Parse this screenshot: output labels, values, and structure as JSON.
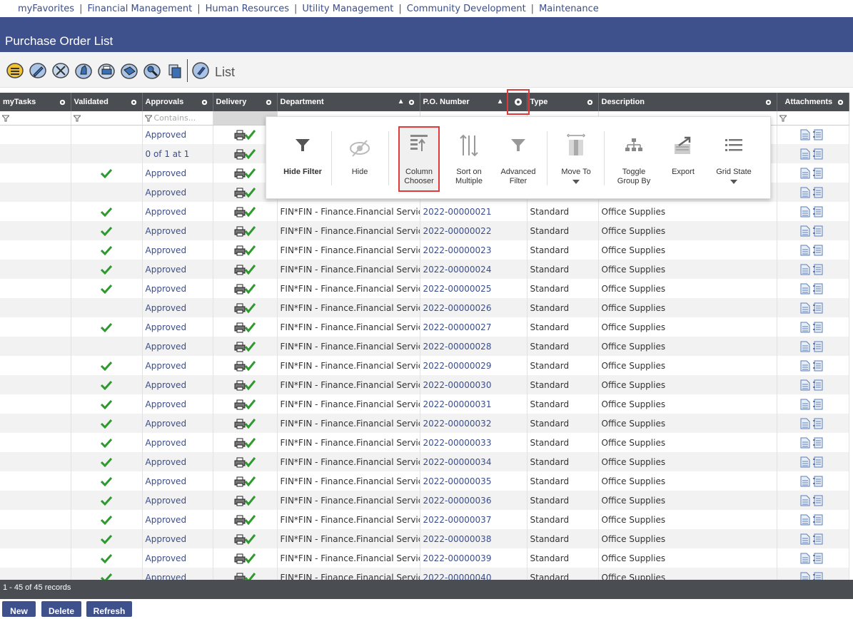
{
  "nav": {
    "items": [
      "myFavorites",
      "Financial Management",
      "Human Resources",
      "Utility Management",
      "Community Development",
      "Maintenance"
    ]
  },
  "title": "Purchase Order List",
  "toolbar": {
    "list_label": "List"
  },
  "columns": [
    "myTasks",
    "Validated",
    "Approvals",
    "Delivery",
    "Department",
    "P.O. Number",
    "Type",
    "Description",
    "Attachments"
  ],
  "filter": {
    "approvals_placeholder": "Contains..."
  },
  "rows": [
    {
      "validated": false,
      "approval": "Approved",
      "department": "",
      "po": "",
      "type": "",
      "description": ""
    },
    {
      "validated": false,
      "approval": "0 of 1 at 1",
      "department": "",
      "po": "",
      "type": "",
      "description": ""
    },
    {
      "validated": true,
      "approval": "Approved",
      "department": "",
      "po": "",
      "type": "",
      "description": ""
    },
    {
      "validated": false,
      "approval": "Approved",
      "department": "",
      "po": "",
      "type": "",
      "description": ""
    },
    {
      "validated": true,
      "approval": "Approved",
      "department": "FIN*FIN - Finance.Financial Services",
      "po": "2022-00000021",
      "type": "Standard",
      "description": "Office Supplies"
    },
    {
      "validated": true,
      "approval": "Approved",
      "department": "FIN*FIN - Finance.Financial Services",
      "po": "2022-00000022",
      "type": "Standard",
      "description": "Office Supplies"
    },
    {
      "validated": true,
      "approval": "Approved",
      "department": "FIN*FIN - Finance.Financial Services",
      "po": "2022-00000023",
      "type": "Standard",
      "description": "Office Supplies"
    },
    {
      "validated": true,
      "approval": "Approved",
      "department": "FIN*FIN - Finance.Financial Services",
      "po": "2022-00000024",
      "type": "Standard",
      "description": "Office Supplies"
    },
    {
      "validated": true,
      "approval": "Approved",
      "department": "FIN*FIN - Finance.Financial Services",
      "po": "2022-00000025",
      "type": "Standard",
      "description": "Office Supplies"
    },
    {
      "validated": false,
      "approval": "Approved",
      "department": "FIN*FIN - Finance.Financial Services",
      "po": "2022-00000026",
      "type": "Standard",
      "description": "Office Supplies"
    },
    {
      "validated": true,
      "approval": "Approved",
      "department": "FIN*FIN - Finance.Financial Services",
      "po": "2022-00000027",
      "type": "Standard",
      "description": "Office Supplies"
    },
    {
      "validated": false,
      "approval": "Approved",
      "department": "FIN*FIN - Finance.Financial Services",
      "po": "2022-00000028",
      "type": "Standard",
      "description": "Office Supplies"
    },
    {
      "validated": true,
      "approval": "Approved",
      "department": "FIN*FIN - Finance.Financial Services",
      "po": "2022-00000029",
      "type": "Standard",
      "description": "Office Supplies"
    },
    {
      "validated": true,
      "approval": "Approved",
      "department": "FIN*FIN - Finance.Financial Services",
      "po": "2022-00000030",
      "type": "Standard",
      "description": "Office Supplies"
    },
    {
      "validated": true,
      "approval": "Approved",
      "department": "FIN*FIN - Finance.Financial Services",
      "po": "2022-00000031",
      "type": "Standard",
      "description": "Office Supplies"
    },
    {
      "validated": true,
      "approval": "Approved",
      "department": "FIN*FIN - Finance.Financial Services",
      "po": "2022-00000032",
      "type": "Standard",
      "description": "Office Supplies"
    },
    {
      "validated": true,
      "approval": "Approved",
      "department": "FIN*FIN - Finance.Financial Services",
      "po": "2022-00000033",
      "type": "Standard",
      "description": "Office Supplies"
    },
    {
      "validated": true,
      "approval": "Approved",
      "department": "FIN*FIN - Finance.Financial Services",
      "po": "2022-00000034",
      "type": "Standard",
      "description": "Office Supplies"
    },
    {
      "validated": true,
      "approval": "Approved",
      "department": "FIN*FIN - Finance.Financial Services",
      "po": "2022-00000035",
      "type": "Standard",
      "description": "Office Supplies"
    },
    {
      "validated": true,
      "approval": "Approved",
      "department": "FIN*FIN - Finance.Financial Services",
      "po": "2022-00000036",
      "type": "Standard",
      "description": "Office Supplies"
    },
    {
      "validated": true,
      "approval": "Approved",
      "department": "FIN*FIN - Finance.Financial Services",
      "po": "2022-00000037",
      "type": "Standard",
      "description": "Office Supplies"
    },
    {
      "validated": true,
      "approval": "Approved",
      "department": "FIN*FIN - Finance.Financial Services",
      "po": "2022-00000038",
      "type": "Standard",
      "description": "Office Supplies"
    },
    {
      "validated": true,
      "approval": "Approved",
      "department": "FIN*FIN - Finance.Financial Services",
      "po": "2022-00000039",
      "type": "Standard",
      "description": "Office Supplies"
    },
    {
      "validated": true,
      "approval": "Approved",
      "department": "FIN*FIN - Finance.Financial Services",
      "po": "2022-00000040",
      "type": "Standard",
      "description": "Office Supplies"
    }
  ],
  "popup": {
    "hide_filter": "Hide Filter",
    "hide": "Hide",
    "column_chooser_1": "Column",
    "column_chooser_2": "Chooser",
    "sort_multiple_1": "Sort on",
    "sort_multiple_2": "Multiple",
    "advanced_filter_1": "Advanced",
    "advanced_filter_2": "Filter",
    "move_to": "Move To",
    "toggle_group_1": "Toggle",
    "toggle_group_2": "Group By",
    "export": "Export",
    "grid_state": "Grid State"
  },
  "status": "1 - 45 of 45 records",
  "buttons": {
    "new": "New",
    "delete": "Delete",
    "refresh": "Refresh"
  },
  "colors": {
    "header_blue": "#3f518c",
    "grid_header": "#4a4d52",
    "link": "#3b4e8c",
    "check_green": "#2e9a2e",
    "highlight_red": "#e03b3b"
  }
}
